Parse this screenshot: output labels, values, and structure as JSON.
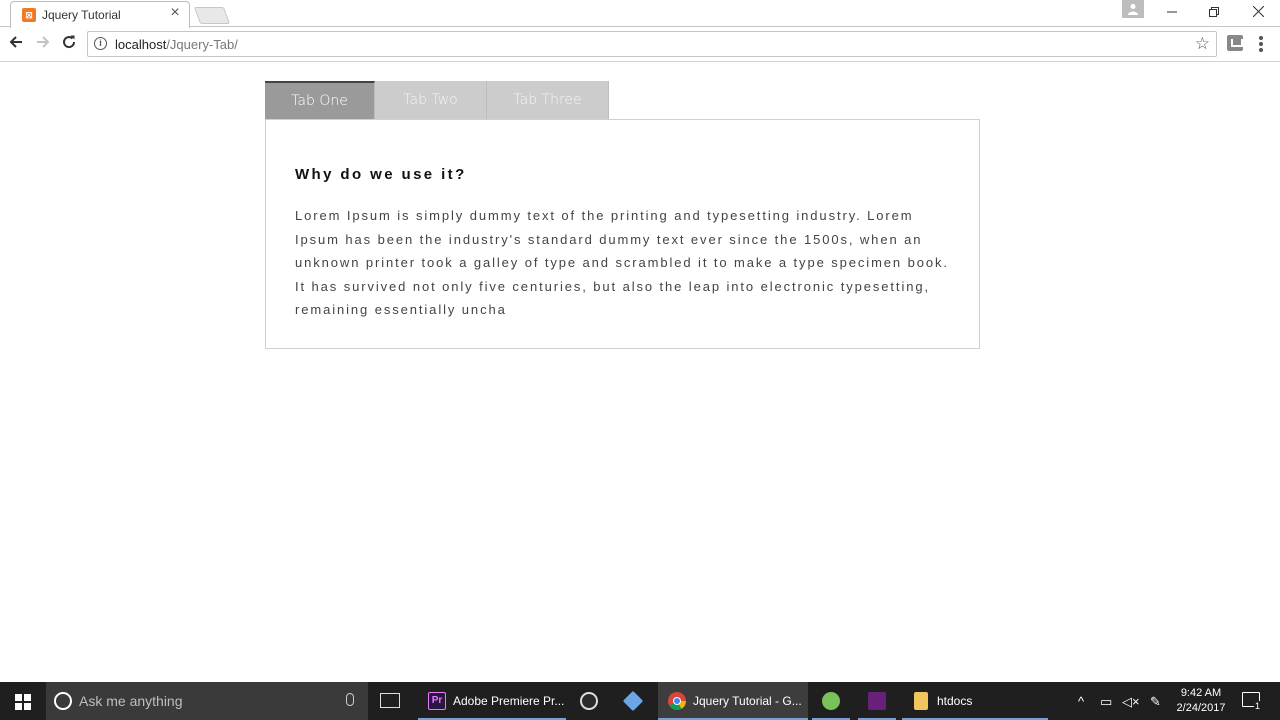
{
  "browser": {
    "tab_title": "Jquery Tutorial",
    "url_host": "localhost",
    "url_path": "/Jquery-Tab/"
  },
  "page": {
    "tabs": [
      {
        "label": "Tab One",
        "active": true
      },
      {
        "label": "Tab Two",
        "active": false
      },
      {
        "label": "Tab Three",
        "active": false
      }
    ],
    "heading": "Why do we use it?",
    "body": "Lorem Ipsum is simply dummy text of the printing and typesetting industry. Lorem Ipsum has been the industry's standard dummy text ever since the 1500s, when an unknown printer took a galley of type and scrambled it to make a type specimen book. It has survived not only five centuries, but also the leap into electronic typesetting, remaining essentially uncha"
  },
  "taskbar": {
    "search_placeholder": "Ask me anything",
    "items": [
      {
        "label": "Adobe Premiere Pr...",
        "icon": "premiere-icon"
      },
      {
        "label": "",
        "icon": "obs-icon"
      },
      {
        "label": "",
        "icon": "box-app-icon"
      },
      {
        "label": "Jquery Tutorial - G...",
        "icon": "chrome-icon"
      },
      {
        "label": "",
        "icon": "android-studio-icon"
      },
      {
        "label": "",
        "icon": "visual-studio-icon"
      },
      {
        "label": "htdocs",
        "icon": "folder-icon"
      }
    ],
    "time": "9:42 AM",
    "date": "2/24/2017",
    "notification_count": "1"
  },
  "colors": {
    "active_tab": "#9a9a9a",
    "inactive_tab": "#cccccc",
    "taskbar": "#1f1f1f"
  }
}
